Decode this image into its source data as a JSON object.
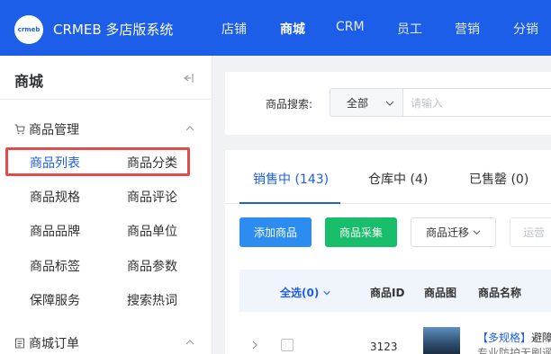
{
  "header": {
    "logo_text": "crmeb",
    "brand": "CRMEB 多店版系统",
    "nav": [
      "店铺",
      "商城",
      "CRM",
      "员工",
      "营销",
      "分销"
    ],
    "active_nav": "商城"
  },
  "sidebar": {
    "title": "商城",
    "groups": [
      {
        "label": "商品管理",
        "icon": "cart-icon",
        "items": [
          "商品列表",
          "商品分类",
          "商品规格",
          "商品评论",
          "商品品牌",
          "商品单位",
          "商品标签",
          "商品参数",
          "保障服务",
          "搜索热词"
        ],
        "active_item": "商品列表"
      },
      {
        "label": "商城订单",
        "icon": "order-icon",
        "items": []
      }
    ]
  },
  "search": {
    "label": "商品搜索:",
    "select_value": "全部",
    "placeholder": "请输入"
  },
  "tabs": [
    "销售中 (143)",
    "仓库中 (4)",
    "已售罄 (0)"
  ],
  "active_tab": "销售中 (143)",
  "toolbar": {
    "add": "添加商品",
    "collect": "商品采集",
    "migrate": "商品迁移",
    "partial": "运营"
  },
  "table": {
    "headers": [
      "全选(0)",
      "商品ID",
      "商品图",
      "商品名称"
    ],
    "rows": [
      {
        "id": "3123",
        "thumb_text": "",
        "name_tag": "【多规格】",
        "name": "避障",
        "name_line2": "专业防护无刷遥"
      }
    ]
  },
  "colors": {
    "primary": "#1c5ee8",
    "button_blue": "#2d8cf0",
    "button_green": "#19be6b",
    "highlight": "#e44b4b"
  }
}
